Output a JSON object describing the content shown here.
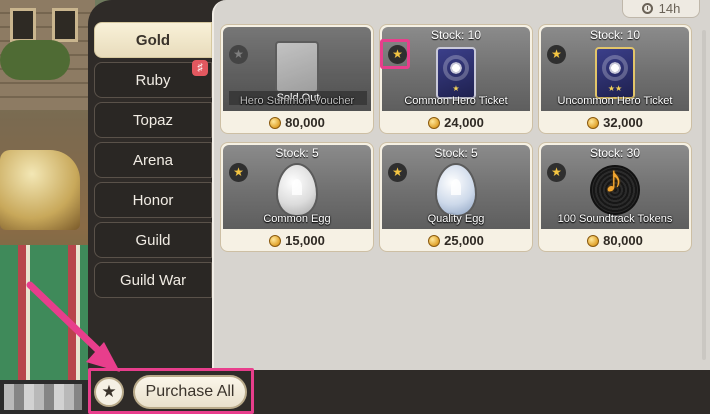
{
  "shop": {
    "timer": "14h",
    "tabs": [
      {
        "label": "Gold",
        "active": true
      },
      {
        "label": "Ruby",
        "badge": "☰"
      },
      {
        "label": "Topaz"
      },
      {
        "label": "Arena"
      },
      {
        "label": "Honor"
      },
      {
        "label": "Guild"
      },
      {
        "label": "Guild War"
      }
    ],
    "items": [
      {
        "name": "Hero Summon Voucher",
        "price": "80,000",
        "status": "Sold Out",
        "favorite": false,
        "icon": "voucher-icon"
      },
      {
        "name": "Common Hero Ticket",
        "price": "24,000",
        "stock": "Stock: 10",
        "favorite": true,
        "icon": "ticket-icon"
      },
      {
        "name": "Uncommon Hero Ticket",
        "price": "32,000",
        "stock": "Stock: 10",
        "favorite": true,
        "icon": "ticket-icon"
      },
      {
        "name": "Common Egg",
        "price": "15,000",
        "stock": "Stock: 5",
        "favorite": true,
        "icon": "egg-icon"
      },
      {
        "name": "Quality Egg",
        "price": "25,000",
        "stock": "Stock: 5",
        "favorite": true,
        "icon": "egg-icon"
      },
      {
        "name": "100 Soundtrack Tokens",
        "price": "80,000",
        "stock": "Stock: 30",
        "favorite": true,
        "icon": "record-icon"
      }
    ],
    "actions": {
      "purchase_all_label": "Purchase All",
      "star_icon": "star-check-icon"
    },
    "colors": {
      "highlight": "#e83e8c",
      "favorite_star": "#f4c542",
      "active_tab": "#f3ead0"
    }
  }
}
